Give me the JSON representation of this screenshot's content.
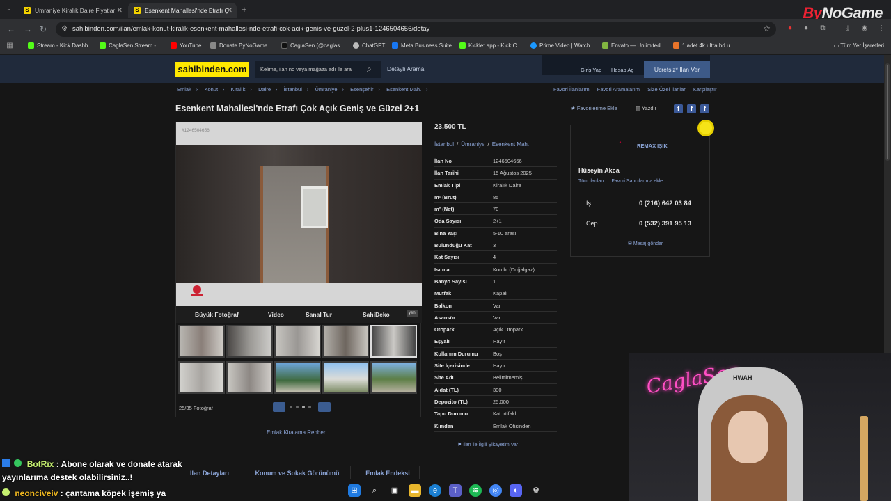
{
  "browser": {
    "tabs": [
      {
        "favicon": "S",
        "title": "Ümraniye Kiralık Daire Fiyatları"
      },
      {
        "favicon": "S",
        "title": "Esenkent Mahallesi'nde Etrafı Ç"
      }
    ],
    "url": "sahibinden.com/ilan/emlak-konut-kiralik-esenkent-mahallesi-nde-etrafi-cok-acik-genis-ve-guzel-2-plus1-1246504656/detay",
    "brand_overlay": {
      "by": "By",
      "rest": "NoGame"
    },
    "bookmarks": [
      "Stream - Kick Dashb...",
      "CaglaSen Stream -...",
      "YouTube",
      "Donate ByNoGame...",
      "CaglaSen (@caglas...",
      "ChatGPT",
      "Meta Business Suite",
      "Kicklet.app - Kick C...",
      "Prime Video | Watch...",
      "Envato — Unlimited...",
      "1 adet 4k ultra hd u..."
    ],
    "bookmarks_all": "Tüm Yer İşaretleri"
  },
  "site": {
    "logo": "sahibinden.com",
    "search_placeholder": "Kelime, ilan no veya mağaza adı ile ara",
    "detailed_search": "Detaylı Arama",
    "login": "Giriş Yap",
    "register": "Hesap Aç",
    "free_ad": "Ücretsiz* İlan Ver",
    "breadcrumbs": [
      "Emlak",
      "›",
      "Konut",
      "›",
      "Kiralık",
      "›",
      "Daire",
      "›",
      "İstanbul",
      "›",
      "Ümraniye",
      "›",
      "Esenşehir",
      "›",
      "Esenkent Mah.",
      "›"
    ],
    "right_links": [
      "Favori İlanlarım",
      "Favori Aramalarım",
      "Size Özel İlanlar",
      "Karşılaştır"
    ]
  },
  "listing": {
    "title": "Esenkent Mahallesi'nde Etrafı Çok Açık Geniş ve Güzel 2+1",
    "add_favorite": "Favorilerime Ekle",
    "print": "Yazdır",
    "price": "23.500 TL",
    "location": {
      "city": "İstanbul",
      "district": "Ümraniye",
      "neighborhood": "Esenkent Mah.",
      "sep": "/"
    },
    "photo_id": "#1246504656",
    "agency_logo_text": "REMAX IŞIK",
    "gallery_tabs": [
      "Büyük Fotoğraf",
      "Video",
      "Sanal Tur",
      "SahiDeko"
    ],
    "new_badge": "yeni",
    "photo_counter": "25/35 Fotoğraf",
    "rental_guide": "Emlak Kiralama Rehberi",
    "details": [
      {
        "k": "İlan No",
        "v": "1246504656"
      },
      {
        "k": "İlan Tarihi",
        "v": "15 Ağustos 2025"
      },
      {
        "k": "Emlak Tipi",
        "v": "Kiralık Daire"
      },
      {
        "k": "m² (Brüt)",
        "v": "85"
      },
      {
        "k": "m² (Net)",
        "v": "70"
      },
      {
        "k": "Oda Sayısı",
        "v": "2+1"
      },
      {
        "k": "Bina Yaşı",
        "v": "5-10 arası"
      },
      {
        "k": "Bulunduğu Kat",
        "v": "3"
      },
      {
        "k": "Kat Sayısı",
        "v": "4"
      },
      {
        "k": "Isıtma",
        "v": "Kombi (Doğalgaz)"
      },
      {
        "k": "Banyo Sayısı",
        "v": "1"
      },
      {
        "k": "Mutfak",
        "v": "Kapalı"
      },
      {
        "k": "Balkon",
        "v": "Var"
      },
      {
        "k": "Asansör",
        "v": "Var"
      },
      {
        "k": "Otopark",
        "v": "Açık Otopark"
      },
      {
        "k": "Eşyalı",
        "v": "Hayır"
      },
      {
        "k": "Kullanım Durumu",
        "v": "Boş"
      },
      {
        "k": "Site İçerisinde",
        "v": "Hayır"
      },
      {
        "k": "Site Adı",
        "v": "Belirtilmemiş"
      },
      {
        "k": "Aidat (TL)",
        "v": "300"
      },
      {
        "k": "Depozito (TL)",
        "v": "25.000"
      },
      {
        "k": "Tapu Durumu",
        "v": "Kat İrtifaklı"
      },
      {
        "k": "Kimden",
        "v": "Emlak Ofisinden"
      }
    ],
    "complaint": "İlan ile İlgili Şikayetim Var",
    "bottom_tabs": [
      "İlan Detayları",
      "Konum ve Sokak Görünümü",
      "Emlak Endeksi"
    ]
  },
  "seller": {
    "agency": "REMAX IŞIK",
    "name": "Hüseyin Akca",
    "links": [
      "Tüm ilanları",
      "Favori Satıcılarıma ekle"
    ],
    "phones": [
      {
        "label": "İş",
        "value": "0 (216) 642 03 84"
      },
      {
        "label": "Cep",
        "value": "0 (532) 391 95 13"
      }
    ],
    "message": "Mesaj gönder"
  },
  "chat": [
    {
      "user": "BotRix",
      "text": ": Abone olarak ve donate atarak"
    },
    {
      "user": "",
      "text": "yayınlarıma destek olabilirsiniz..!"
    },
    {
      "user": "neonciveiv",
      "text": ": çantama köpek işemiş ya"
    }
  ],
  "webcam": {
    "neon_sign": "CaglaSen",
    "chair_text": "HWAH"
  },
  "colors": {
    "logo_yellow": "#ffe800",
    "link_blue": "#8ba4d6",
    "header_navy": "#202a3b",
    "neon_pink": "#ff4fc4"
  }
}
